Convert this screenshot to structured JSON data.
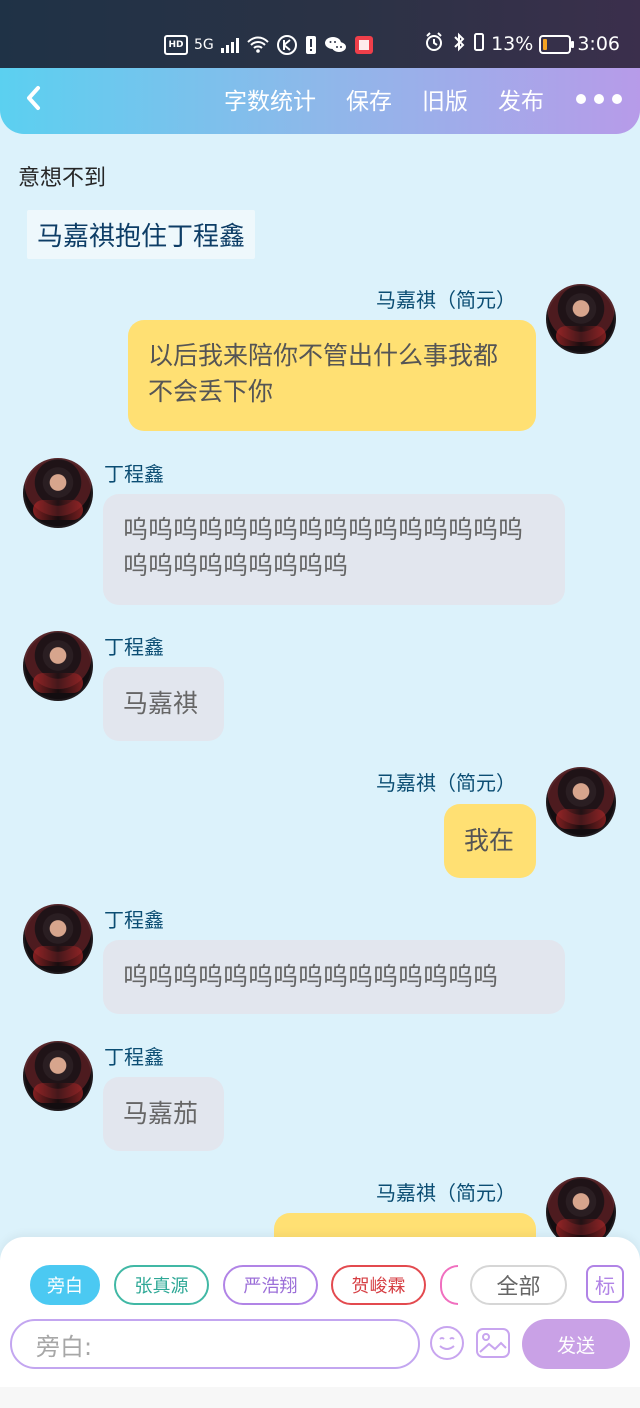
{
  "status_bar": {
    "hd": "HD",
    "network": "5G",
    "battery_percent": "13%",
    "time": "3:06",
    "battery_level": 0.13
  },
  "header": {
    "actions": [
      "字数统计",
      "保存",
      "旧版",
      "发布"
    ]
  },
  "chapter": {
    "title": "意想不到",
    "subtitle": "马嘉祺抱住丁程鑫"
  },
  "messages": [
    {
      "side": "right",
      "name": "马嘉祺（简元）",
      "text": "以后我来陪你不管出什么事我都不会丢下你"
    },
    {
      "side": "left",
      "name": "丁程鑫",
      "text": "呜呜呜呜呜呜呜呜呜呜呜呜呜呜呜呜呜呜呜呜呜呜呜呜呜"
    },
    {
      "side": "left",
      "name": "丁程鑫",
      "text": "马嘉祺"
    },
    {
      "side": "right",
      "name": "马嘉祺（简元）",
      "text": "我在"
    },
    {
      "side": "left",
      "name": "丁程鑫",
      "text": "呜呜呜呜呜呜呜呜呜呜呜呜呜呜呜"
    },
    {
      "side": "left",
      "name": "丁程鑫",
      "text": "马嘉茄"
    },
    {
      "side": "right",
      "name": "马嘉祺（简元）",
      "text": ""
    }
  ],
  "bottom_panel": {
    "chips": [
      "旁白",
      "张真源",
      "严浩翔",
      "贺峻霖"
    ],
    "all_label": "全部",
    "mark_label": "标",
    "input_placeholder": "旁白:",
    "send_label": "发送"
  },
  "colors": {
    "header_start": "#5bd0f0",
    "header_end": "#b79be9",
    "right_bubble": "#ffe073",
    "left_bubble": "#e2e6ee",
    "name_color": "#0b4d73"
  }
}
